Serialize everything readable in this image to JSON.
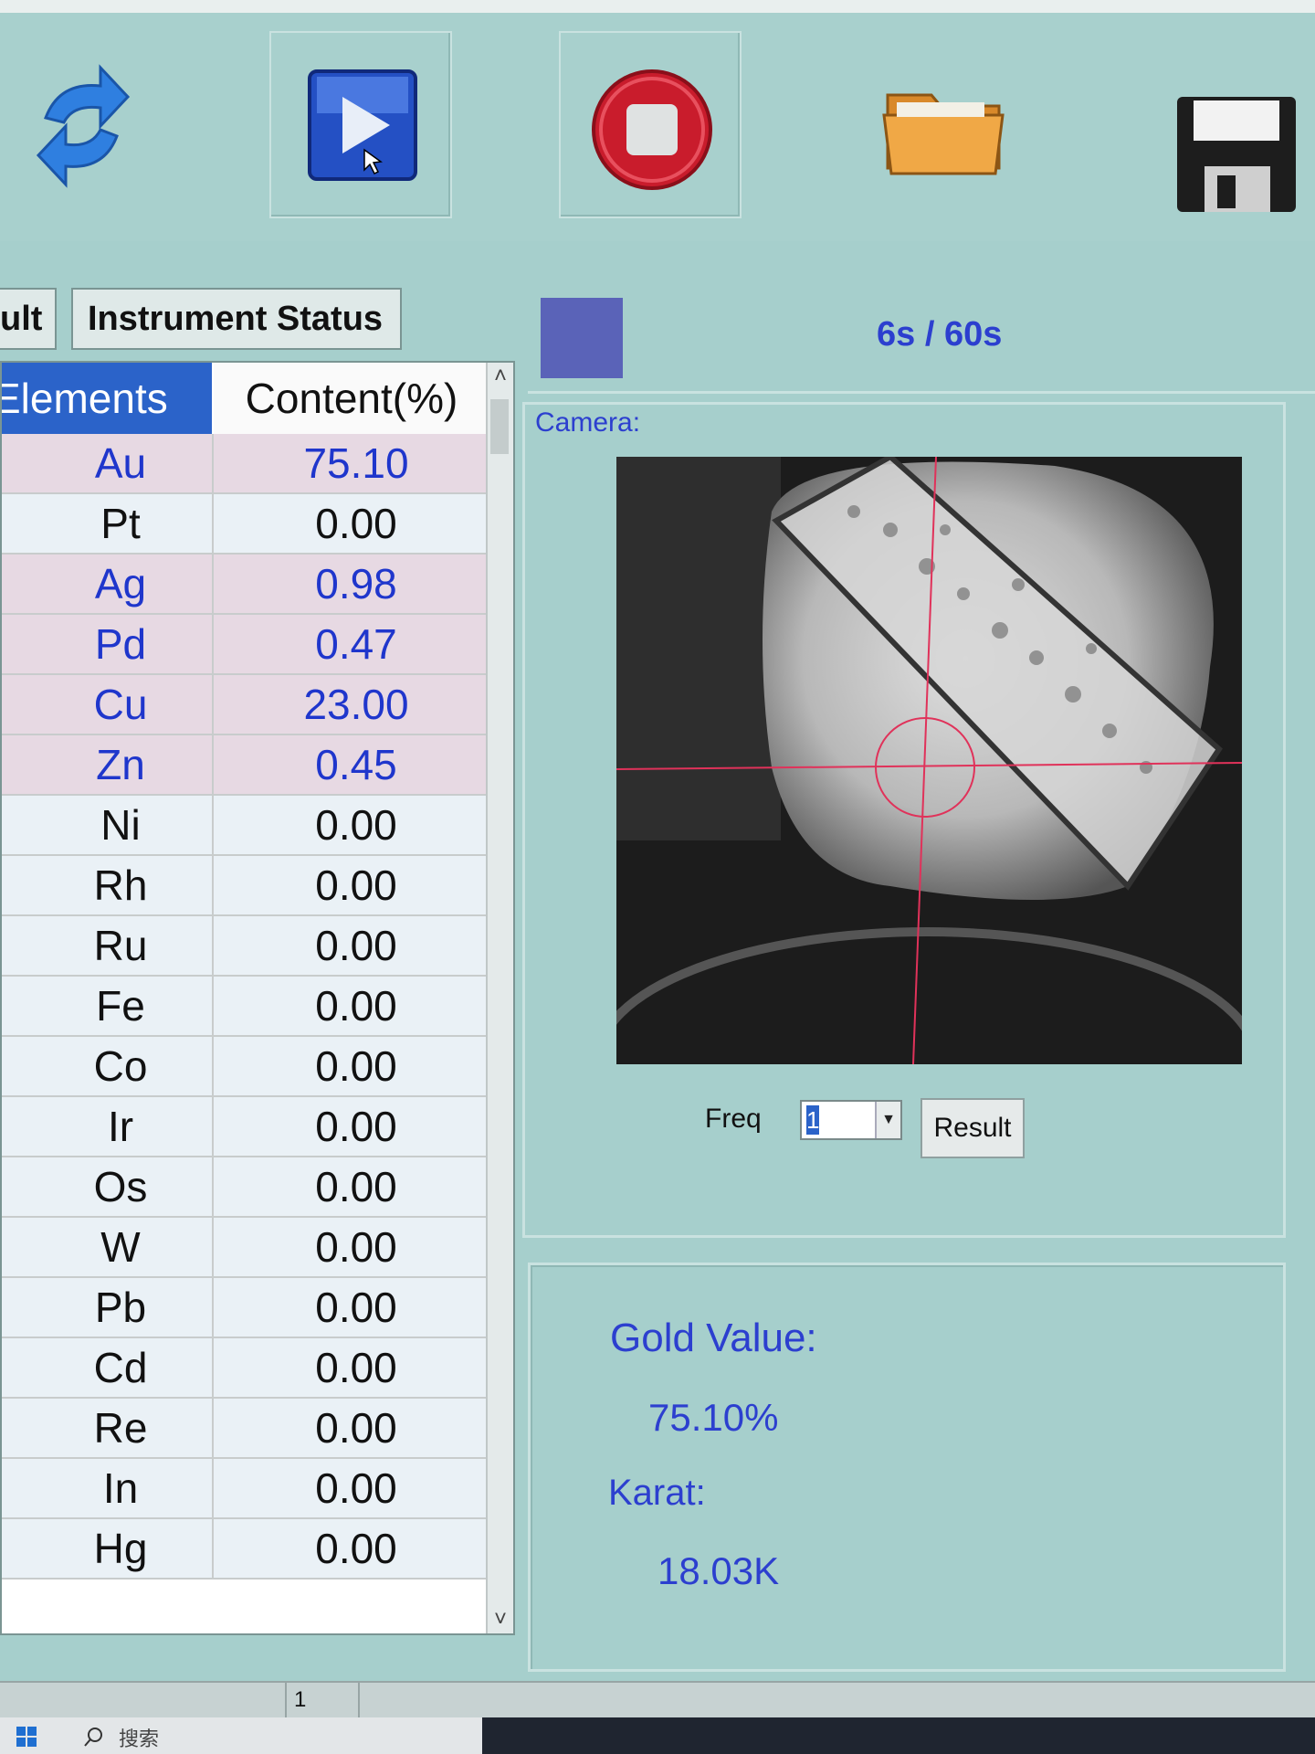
{
  "toolbar": {
    "buttons": [
      {
        "name": "refresh",
        "icon": "refresh-icon"
      },
      {
        "name": "start",
        "icon": "play-icon"
      },
      {
        "name": "stop",
        "icon": "stop-icon"
      },
      {
        "name": "open",
        "icon": "folder-icon"
      },
      {
        "name": "save",
        "icon": "floppy-disk-icon"
      }
    ]
  },
  "tabs": [
    {
      "label": "ult"
    },
    {
      "label": "Instrument Status"
    }
  ],
  "table": {
    "headers": {
      "element": "Elements",
      "content": "Content(%)"
    },
    "rows": [
      {
        "element": "Au",
        "value": "75.10",
        "highlight": true
      },
      {
        "element": "Pt",
        "value": "0.00",
        "highlight": false
      },
      {
        "element": "Ag",
        "value": "0.98",
        "highlight": true
      },
      {
        "element": "Pd",
        "value": "0.47",
        "highlight": true
      },
      {
        "element": "Cu",
        "value": "23.00",
        "highlight": true
      },
      {
        "element": "Zn",
        "value": "0.45",
        "highlight": true
      },
      {
        "element": "Ni",
        "value": "0.00",
        "highlight": false
      },
      {
        "element": "Rh",
        "value": "0.00",
        "highlight": false
      },
      {
        "element": "Ru",
        "value": "0.00",
        "highlight": false
      },
      {
        "element": "Fe",
        "value": "0.00",
        "highlight": false
      },
      {
        "element": "Co",
        "value": "0.00",
        "highlight": false
      },
      {
        "element": "Ir",
        "value": "0.00",
        "highlight": false
      },
      {
        "element": "Os",
        "value": "0.00",
        "highlight": false
      },
      {
        "element": "W",
        "value": "0.00",
        "highlight": false
      },
      {
        "element": "Pb",
        "value": "0.00",
        "highlight": false
      },
      {
        "element": "Cd",
        "value": "0.00",
        "highlight": false
      },
      {
        "element": "Re",
        "value": "0.00",
        "highlight": false
      },
      {
        "element": "In",
        "value": "0.00",
        "highlight": false
      },
      {
        "element": "Hg",
        "value": "0.00",
        "highlight": false
      }
    ]
  },
  "progress": {
    "text": "6s / 60s",
    "fraction": 0.1
  },
  "camera": {
    "label": "Camera:"
  },
  "controls": {
    "freq_label": "Freq",
    "freq_value": "1",
    "result_button": "Result"
  },
  "gold": {
    "gold_value_label": "Gold Value:",
    "gold_value": "75.10%",
    "karat_label": "Karat:",
    "karat_value": "18.03K"
  },
  "statusbar": {
    "page": "1"
  },
  "taskbar": {
    "search_text": "搜索"
  },
  "colors": {
    "accent_blue": "#2c3fcf",
    "header_blue": "#2b63c9",
    "highlight_row": "#e7d9e3",
    "panel_bg": "#a6cfcc"
  }
}
